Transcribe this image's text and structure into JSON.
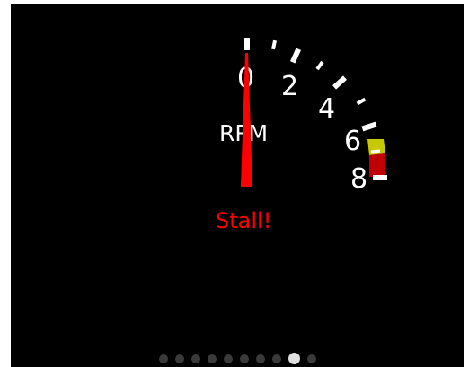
{
  "gauge": {
    "unit_label": "RPM",
    "status_text": "Stall!",
    "value": 0,
    "scale": {
      "min": 0,
      "max": 8
    },
    "tick_labels": [
      "0",
      "2",
      "4",
      "6",
      "8"
    ],
    "colors": {
      "needle": "#ff0000",
      "status": "#ff0000",
      "ticks": "#ffffff",
      "warning_zone": "#c8c800",
      "redline_zone": "#c00000",
      "background": "#000000"
    }
  },
  "pager": {
    "page_count": 10,
    "active_index": 8
  }
}
